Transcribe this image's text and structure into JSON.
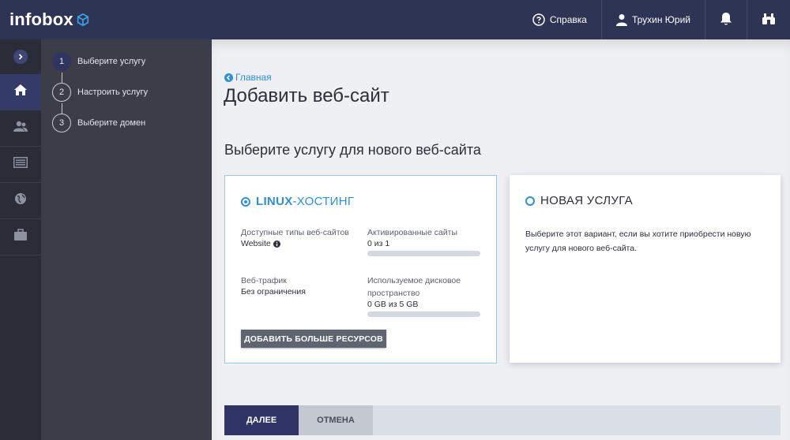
{
  "header": {
    "logo": "infobox",
    "help_label": "Справка",
    "user_label": "Трухин Юрий"
  },
  "steps": [
    {
      "num": "1",
      "label": "Выберите услугу"
    },
    {
      "num": "2",
      "label": "Настроить услугу"
    },
    {
      "num": "3",
      "label": "Выберите домен"
    }
  ],
  "main": {
    "breadcrumb": "Главная",
    "title": "Добавить веб-сайт",
    "section_title": "Выберите услугу для нового веб-сайта"
  },
  "card_hosting": {
    "title_prefix": "LINUX",
    "title_suffix": "-ХОСТИНГ",
    "site_types_label": "Доступные типы веб-сайтов",
    "site_types_value": "Website",
    "activated_label": "Активированные сайты",
    "activated_value": "0 из 1",
    "activated_fraction": 0,
    "traffic_label": "Веб-трафик",
    "traffic_value": "Без ограничения",
    "disk_label": "Используемое дисковое пространство",
    "disk_value": "0 GB из 5 GB",
    "disk_fraction": 0,
    "more_button": "ДОБАВИТЬ БОЛЬШЕ РЕСУРСОВ"
  },
  "card_new": {
    "title": "НОВАЯ УСЛУГА",
    "description": "Выберите этот вариант, если вы хотите приобрести новую услугу для нового веб-сайта."
  },
  "actions": {
    "next": "ДАЛЕЕ",
    "cancel": "ОТМЕНА"
  },
  "colors": {
    "topbar": "#2e3554",
    "accent": "#2d8fd6",
    "primary_button": "#2f3464"
  }
}
